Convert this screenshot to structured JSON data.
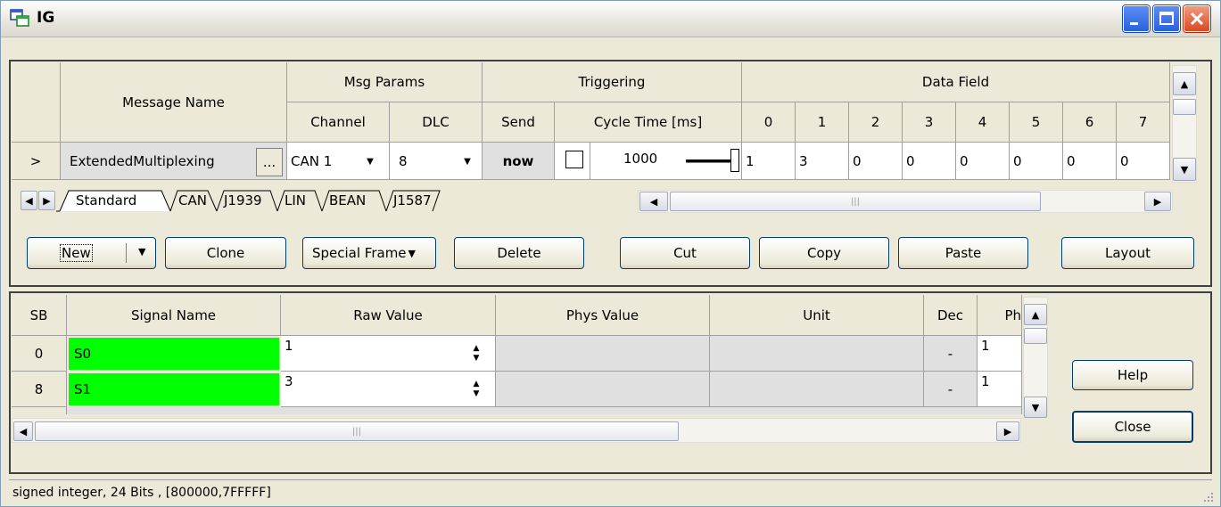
{
  "window": {
    "title": "IG"
  },
  "message_table": {
    "headers": {
      "message_name": "Message Name",
      "msg_params": "Msg Params",
      "triggering": "Triggering",
      "data_field": "Data Field",
      "channel": "Channel",
      "dlc": "DLC",
      "send": "Send",
      "cycle_time": "Cycle Time [ms]",
      "byte_indices": [
        "0",
        "1",
        "2",
        "3",
        "4",
        "5",
        "6",
        "7"
      ]
    },
    "row": {
      "marker": ">",
      "name": "ExtendedMultiplexing",
      "name_more": "...",
      "channel": "CAN 1",
      "dlc": "8",
      "send": "now",
      "cycle_time": "1000",
      "data": [
        "1",
        "3",
        "0",
        "0",
        "0",
        "0",
        "0",
        "0"
      ]
    }
  },
  "tabs": [
    "Standard",
    "CAN",
    "J1939",
    "LIN",
    "BEAN",
    "J1587"
  ],
  "buttons": {
    "new": "New",
    "clone": "Clone",
    "special_frame": "Special Frame",
    "delete": "Delete",
    "cut": "Cut",
    "copy": "Copy",
    "paste": "Paste",
    "layout": "Layout",
    "help": "Help",
    "close": "Close"
  },
  "signal_table": {
    "headers": {
      "sb": "SB",
      "signal_name": "Signal Name",
      "raw_value": "Raw Value",
      "phys_value": "Phys Value",
      "unit": "Unit",
      "dec": "Dec",
      "ph": "Ph"
    },
    "rows": [
      {
        "sb": "0",
        "name": "S0",
        "raw": "1",
        "dec": "-",
        "ph": "1"
      },
      {
        "sb": "8",
        "name": "S1",
        "raw": "3",
        "dec": "-",
        "ph": "1"
      }
    ]
  },
  "status_text": "signed integer, 24 Bits , [800000,7FFFFF]",
  "colors": {
    "signal_bg": "#00ff00",
    "title_close": "#d84a24",
    "title_buttons": "#2b61dc"
  },
  "icons": {
    "app": "ig-window-icon",
    "minimize": "minimize-icon",
    "maximize": "maximize-icon",
    "close": "close-icon"
  }
}
